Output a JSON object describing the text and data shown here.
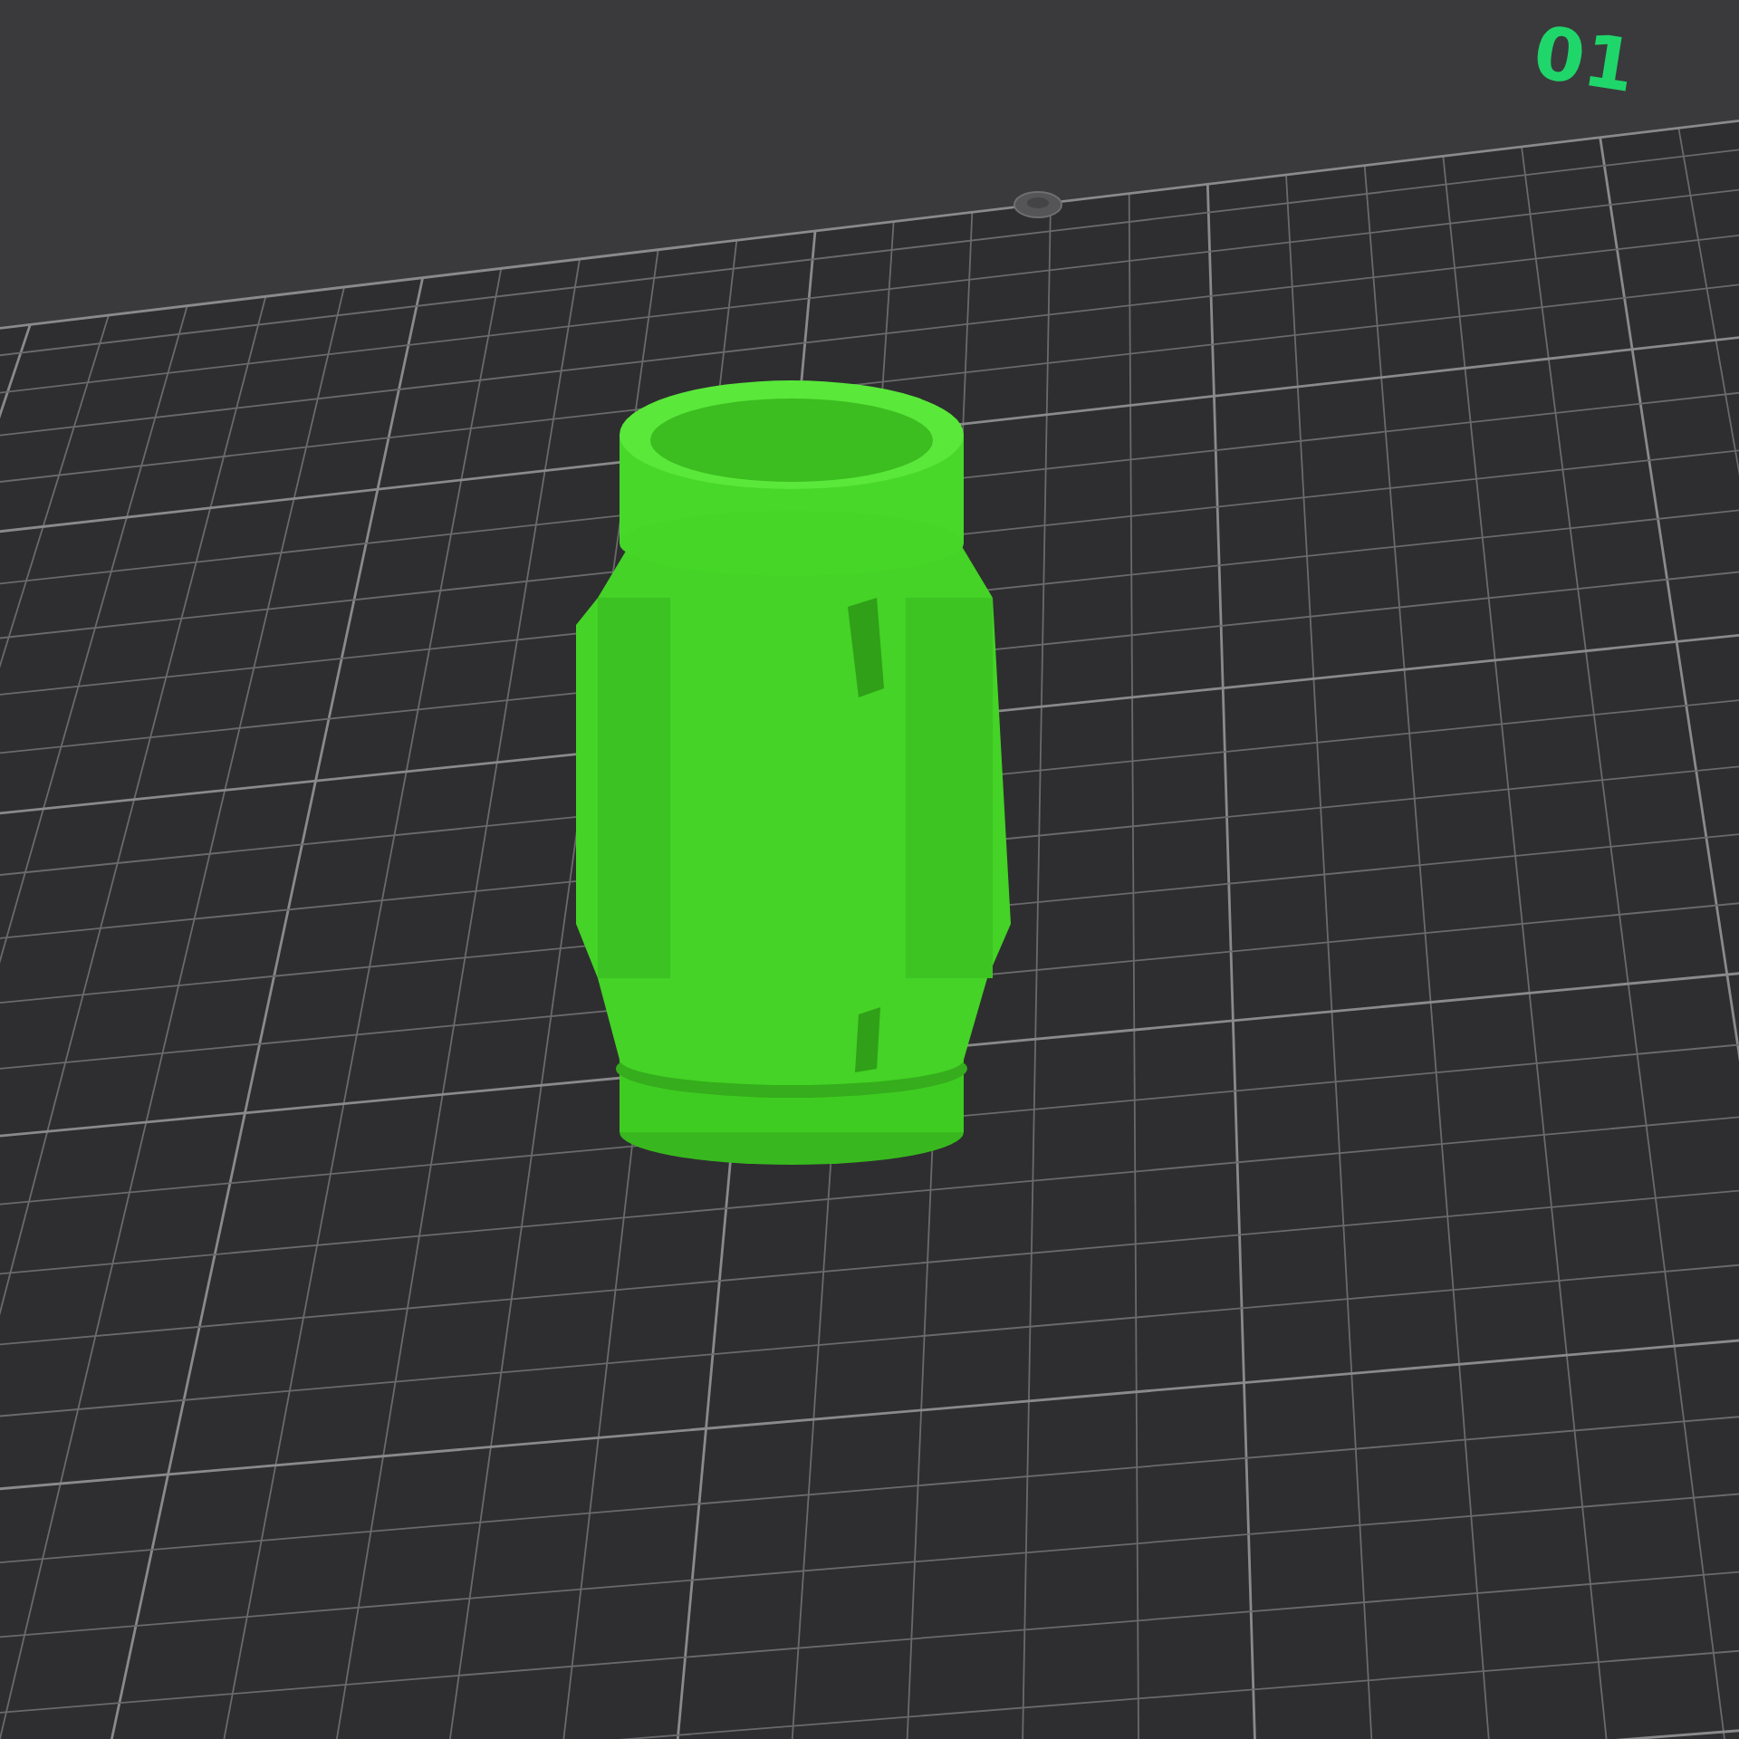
{
  "viewport": {
    "plate_label": "01"
  }
}
